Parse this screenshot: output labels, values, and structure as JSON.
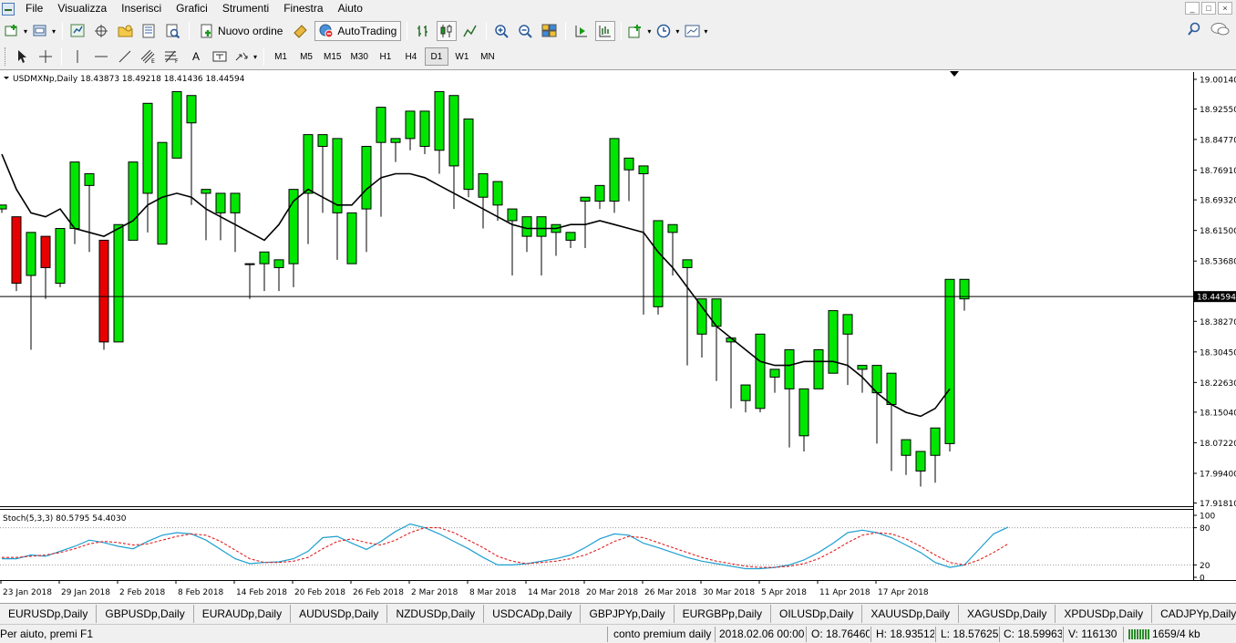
{
  "menu": [
    "File",
    "Visualizza",
    "Inserisci",
    "Grafici",
    "Strumenti",
    "Finestra",
    "Aiuto"
  ],
  "toolbar": {
    "new_order_label": "Nuovo ordine",
    "autotrading_label": "AutoTrading",
    "timeframes": [
      "M1",
      "M5",
      "M15",
      "M30",
      "H1",
      "H4",
      "D1",
      "W1",
      "MN"
    ],
    "active_timeframe": "D1"
  },
  "chart": {
    "header": "USDMXNp,Daily  18.43873 18.49218 18.41436 18.44594",
    "current_price_label": "18.44594",
    "indicator_header": "Stoch(5,3,3) 80.5795 54.4030"
  },
  "chart_data": {
    "type": "candlestick",
    "symbol": "USDMXNp",
    "timeframe": "Daily",
    "ohlc_header": {
      "open": 18.43873,
      "high": 18.49218,
      "low": 18.41436,
      "close": 18.44594
    },
    "price_axis_ticks": [
      "19.00140",
      "18.92550",
      "18.84770",
      "18.76910",
      "18.69320",
      "18.61500",
      "18.53680",
      "18.45860",
      "18.38270",
      "18.30450",
      "18.22630",
      "18.15040",
      "18.07220",
      "17.99400",
      "17.91810"
    ],
    "date_labels": [
      "23 Jan 2018",
      "29 Jan 2018",
      "2 Feb 2018",
      "8 Feb 2018",
      "14 Feb 2018",
      "20 Feb 2018",
      "26 Feb 2018",
      "2 Mar 2018",
      "8 Mar 2018",
      "14 Mar 2018",
      "20 Mar 2018",
      "26 Mar 2018",
      "30 Mar 2018",
      "5 Apr 2018",
      "11 Apr 2018",
      "17 Apr 2018"
    ],
    "ylim": [
      17.91,
      19.02
    ],
    "bull_color": "#00e600",
    "bear_color": "#e60000",
    "ma_color": "#000000",
    "candles": [
      [
        18.67,
        18.67,
        18.66,
        18.68
      ],
      [
        18.65,
        18.65,
        18.46,
        18.48
      ],
      [
        18.5,
        18.5,
        18.31,
        18.61
      ],
      [
        18.6,
        18.6,
        18.44,
        18.52
      ],
      [
        18.48,
        18.48,
        18.47,
        18.62
      ],
      [
        18.62,
        18.72,
        18.58,
        18.79
      ],
      [
        18.73,
        18.73,
        18.56,
        18.76
      ],
      [
        18.59,
        18.59,
        18.31,
        18.33
      ],
      [
        18.33,
        18.33,
        18.33,
        18.63
      ],
      [
        18.59,
        18.59,
        18.63,
        18.79
      ],
      [
        18.71,
        18.71,
        18.61,
        18.94
      ],
      [
        18.58,
        18.58,
        18.79,
        18.84
      ],
      [
        18.8,
        18.8,
        18.86,
        18.97
      ],
      [
        18.89,
        18.89,
        18.68,
        18.96
      ],
      [
        18.71,
        18.71,
        18.59,
        18.72
      ],
      [
        18.66,
        18.66,
        18.59,
        18.71
      ],
      [
        18.66,
        18.66,
        18.56,
        18.71
      ],
      [
        18.53,
        18.53,
        18.44,
        18.53
      ],
      [
        18.53,
        18.53,
        18.46,
        18.56
      ],
      [
        18.52,
        18.52,
        18.46,
        18.54
      ],
      [
        18.53,
        18.53,
        18.47,
        18.72
      ],
      [
        18.71,
        18.71,
        18.58,
        18.86
      ],
      [
        18.83,
        18.83,
        18.66,
        18.86
      ],
      [
        18.66,
        18.66,
        18.54,
        18.85
      ],
      [
        18.53,
        18.53,
        18.56,
        18.66
      ],
      [
        18.67,
        18.67,
        18.56,
        18.83
      ],
      [
        18.84,
        18.84,
        18.65,
        18.93
      ],
      [
        18.84,
        18.84,
        18.79,
        18.85
      ],
      [
        18.85,
        18.85,
        18.82,
        18.92
      ],
      [
        18.83,
        18.83,
        18.81,
        18.92
      ],
      [
        18.82,
        18.82,
        18.76,
        18.97
      ],
      [
        18.78,
        18.78,
        18.67,
        18.96
      ],
      [
        18.72,
        18.72,
        18.7,
        18.9
      ],
      [
        18.7,
        18.7,
        18.62,
        18.76
      ],
      [
        18.68,
        18.68,
        18.64,
        18.74
      ],
      [
        18.64,
        18.64,
        18.5,
        18.67
      ],
      [
        18.6,
        18.6,
        18.56,
        18.65
      ],
      [
        18.6,
        18.6,
        18.5,
        18.65
      ],
      [
        18.61,
        18.61,
        18.55,
        18.63
      ],
      [
        18.59,
        18.59,
        18.57,
        18.61
      ],
      [
        18.69,
        18.69,
        18.57,
        18.7
      ],
      [
        18.69,
        18.69,
        18.67,
        18.73
      ],
      [
        18.69,
        18.69,
        18.66,
        18.85
      ],
      [
        18.77,
        18.77,
        18.69,
        18.8
      ],
      [
        18.76,
        18.76,
        18.4,
        18.78
      ],
      [
        18.42,
        18.42,
        18.4,
        18.64
      ],
      [
        18.61,
        18.61,
        18.5,
        18.63
      ],
      [
        18.52,
        18.52,
        18.27,
        18.54
      ],
      [
        18.35,
        18.35,
        18.29,
        18.44
      ],
      [
        18.37,
        18.37,
        18.23,
        18.44
      ],
      [
        18.33,
        18.33,
        18.16,
        18.34
      ],
      [
        18.18,
        18.18,
        18.15,
        18.22
      ],
      [
        18.16,
        18.16,
        18.15,
        18.35
      ],
      [
        18.24,
        18.24,
        18.2,
        18.26
      ],
      [
        18.21,
        18.21,
        18.06,
        18.31
      ],
      [
        18.09,
        18.09,
        18.05,
        18.21
      ],
      [
        18.21,
        18.21,
        18.21,
        18.31
      ],
      [
        18.25,
        18.25,
        18.28,
        18.41
      ],
      [
        18.35,
        18.35,
        18.22,
        18.4
      ],
      [
        18.26,
        18.26,
        18.2,
        18.27
      ],
      [
        18.2,
        18.2,
        18.07,
        18.27
      ],
      [
        18.17,
        18.17,
        18.0,
        18.25
      ],
      [
        18.04,
        18.04,
        17.99,
        18.08
      ],
      [
        18.0,
        18.0,
        17.96,
        18.05
      ],
      [
        18.04,
        18.04,
        17.97,
        18.11
      ],
      [
        18.07,
        18.07,
        18.05,
        18.49
      ],
      [
        18.44,
        18.44,
        18.41,
        18.49
      ]
    ],
    "ma": [
      18.81,
      18.72,
      18.66,
      18.65,
      18.67,
      18.62,
      18.61,
      18.6,
      18.62,
      18.64,
      18.68,
      18.7,
      18.71,
      18.7,
      18.67,
      18.65,
      18.63,
      18.61,
      18.59,
      18.63,
      18.69,
      18.72,
      18.7,
      18.68,
      18.68,
      18.72,
      18.75,
      18.76,
      18.76,
      18.75,
      18.73,
      18.71,
      18.69,
      18.67,
      18.65,
      18.63,
      18.62,
      18.62,
      18.62,
      18.63,
      18.63,
      18.64,
      18.63,
      18.62,
      18.61,
      18.56,
      18.52,
      18.47,
      18.42,
      18.37,
      18.34,
      18.31,
      18.28,
      18.27,
      18.27,
      18.28,
      18.28,
      18.28,
      18.27,
      18.24,
      18.2,
      18.17,
      18.15,
      18.14,
      18.16,
      18.21
    ],
    "stochastic": {
      "params": "5,3,3",
      "main": 80.5795,
      "signal": 54.403,
      "levels": [
        80,
        20
      ],
      "main_values": [
        30,
        30,
        36,
        34,
        42,
        50,
        60,
        56,
        50,
        46,
        58,
        68,
        72,
        70,
        60,
        45,
        30,
        22,
        24,
        25,
        30,
        42,
        64,
        66,
        55,
        45,
        58,
        74,
        86,
        80,
        70,
        58,
        46,
        32,
        20,
        20,
        22,
        26,
        30,
        36,
        48,
        62,
        70,
        68,
        55,
        48,
        40,
        32,
        26,
        22,
        18,
        14,
        14,
        16,
        20,
        28,
        40,
        55,
        72,
        76,
        72,
        64,
        52,
        40,
        24,
        16,
        20,
        45,
        70,
        81
      ],
      "signal_values": [
        32,
        32,
        34,
        36,
        40,
        46,
        54,
        58,
        56,
        52,
        54,
        60,
        66,
        70,
        68,
        58,
        44,
        30,
        24,
        24,
        26,
        32,
        46,
        58,
        62,
        56,
        52,
        60,
        72,
        80,
        80,
        72,
        60,
        48,
        34,
        26,
        22,
        24,
        26,
        30,
        36,
        46,
        58,
        66,
        64,
        56,
        48,
        40,
        32,
        26,
        22,
        18,
        16,
        16,
        18,
        22,
        30,
        42,
        56,
        68,
        72,
        70,
        62,
        50,
        36,
        24,
        20,
        28,
        40,
        54
      ]
    }
  },
  "sheet_tabs": [
    "EURUSDp,Daily",
    "GBPUSDp,Daily",
    "EURAUDp,Daily",
    "AUDUSDp,Daily",
    "NZDUSDp,Daily",
    "USDCADp,Daily",
    "GBPJPYp,Daily",
    "EURGBPp,Daily",
    "OILUSDp,Daily",
    "XAUUSDp,Daily",
    "XAGUSDp,Daily",
    "XPDUSDp,Daily",
    "CADJPYp,Daily"
  ],
  "status": {
    "help": "Per aiuto, premi F1",
    "profile": "conto premium daily",
    "datetime": "2018.02.06 00:00",
    "open": "O: 18.76460",
    "high": "H: 18.93512",
    "low": "L: 18.57625",
    "close": "C: 18.59963",
    "volume": "V: 116130",
    "traffic": "1659/4 kb"
  }
}
